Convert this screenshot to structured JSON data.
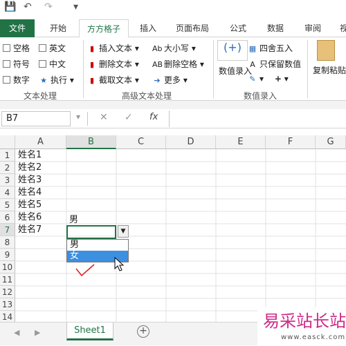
{
  "qat": {
    "save": "💾",
    "undo": "↶",
    "redo": "↷",
    "more": "▾"
  },
  "tabs": [
    "文件",
    "开始",
    "方方格子",
    "插入",
    "页面布局",
    "公式",
    "数据",
    "审阅",
    "视"
  ],
  "ribbon": {
    "group1": {
      "items": [
        "空格",
        "英文",
        "符号",
        "中文",
        "数字",
        "执行"
      ],
      "label": "文本处理"
    },
    "group2": {
      "items": [
        "插入文本",
        "删除文本",
        "截取文本",
        "大小写",
        "删除空格",
        "更多"
      ],
      "label": "高级文本处理"
    },
    "group3": {
      "items": [
        "数值录入",
        "四舍五入",
        "只保留数值"
      ],
      "label": "数值录入"
    },
    "group4": {
      "items": [
        "复制粘贴"
      ]
    }
  },
  "formula": {
    "namebox": "B7",
    "cancel": "✕",
    "enter": "✓",
    "fx": "fx"
  },
  "columns": [
    "A",
    "B",
    "C",
    "D",
    "E",
    "F",
    "G"
  ],
  "rows": [
    "1",
    "2",
    "3",
    "4",
    "5",
    "6",
    "7",
    "8",
    "9",
    "10",
    "11",
    "12",
    "13",
    "14"
  ],
  "cells": {
    "a": [
      "姓名1",
      "姓名2",
      "姓名3",
      "姓名4",
      "姓名5",
      "姓名6",
      "姓名7"
    ],
    "b6": "男"
  },
  "dropdown": {
    "options": [
      "男",
      "女"
    ]
  },
  "sheet": {
    "tab": "Sheet1",
    "add": "+"
  },
  "watermark": {
    "text": "易采站长站",
    "url": "www.easck.com"
  }
}
